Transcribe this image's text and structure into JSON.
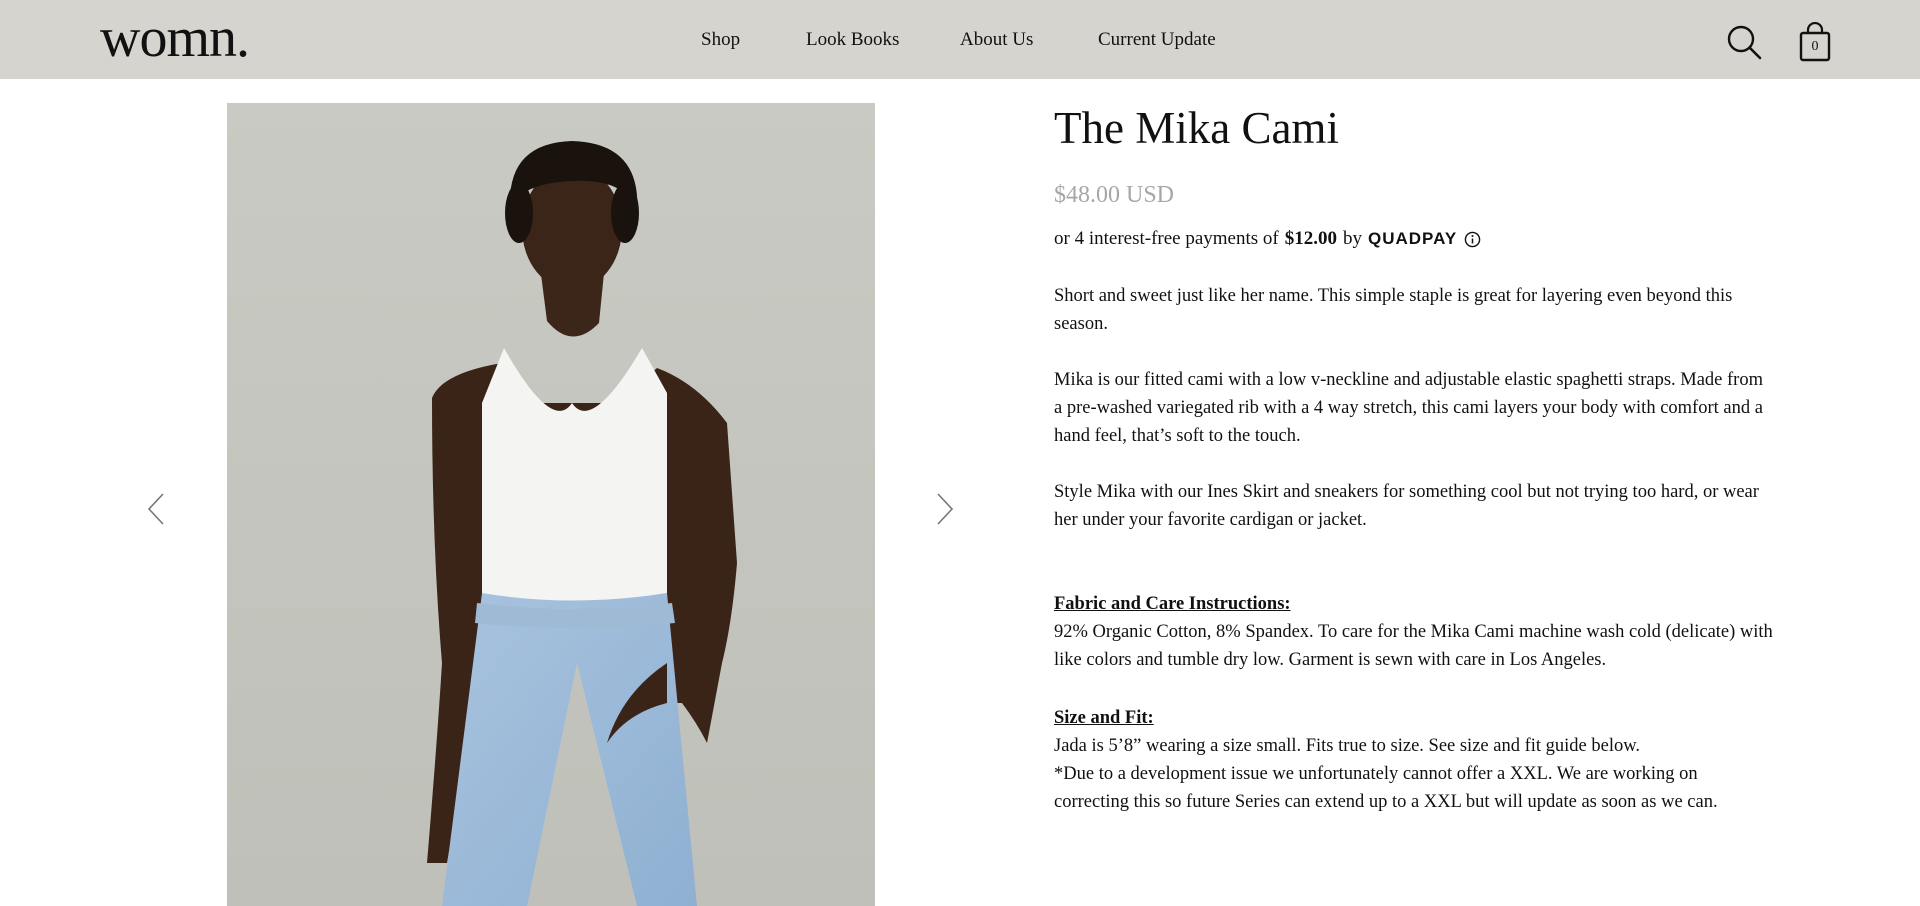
{
  "brand": {
    "logo_text": "womn."
  },
  "nav": {
    "items": [
      {
        "label": "Shop"
      },
      {
        "label": "Look Books"
      },
      {
        "label": "About Us"
      },
      {
        "label": "Current Update"
      }
    ]
  },
  "header": {
    "cart_count": "0",
    "search_icon": "search-icon",
    "cart_icon": "shopping-bag-icon"
  },
  "gallery": {
    "prev_icon": "chevron-left-icon",
    "next_icon": "chevron-right-icon",
    "image_alt": "Model wearing The Mika Cami"
  },
  "product": {
    "title": "The Mika Cami",
    "price": "$48.00 USD",
    "installment_prefix": "or 4 interest-free payments of",
    "installment_amount": "$12.00",
    "installment_by": "by",
    "installment_provider": "QUADPAY",
    "description_1": "Short and sweet just like her name. This simple staple is great for layering even beyond this season.",
    "description_2": "Mika is our fitted cami with a low v-neckline and adjustable elastic spaghetti straps. Made from a pre-washed variegated rib with a 4 way stretch, this cami layers your body with comfort and a hand feel, that’s soft to the touch.",
    "description_3": "Style Mika with our Ines Skirt and sneakers for something cool but not trying too hard, or wear her under your favorite cardigan or jacket.",
    "fabric_heading": "Fabric and Care Instructions:",
    "fabric_text": "92% Organic Cotton, 8% Spandex. To care for the Mika Cami machine wash cold (delicate) with like colors and tumble dry low. Garment is sewn with care in Los Angeles.",
    "size_heading": "Size and Fit:",
    "size_text_1": "Jada is 5’8” wearing a size small. Fits true to size. See size and fit guide below.",
    "size_text_2": "*Due to a development issue we unfortunately cannot offer a XXL. We are working on correcting this so future Series can extend up to a XXL but will update as soon as we can."
  },
  "colors": {
    "header_bg": "#d6d4ce",
    "price": "#a7a7a7",
    "photo_bg": "#c6c7c0"
  }
}
